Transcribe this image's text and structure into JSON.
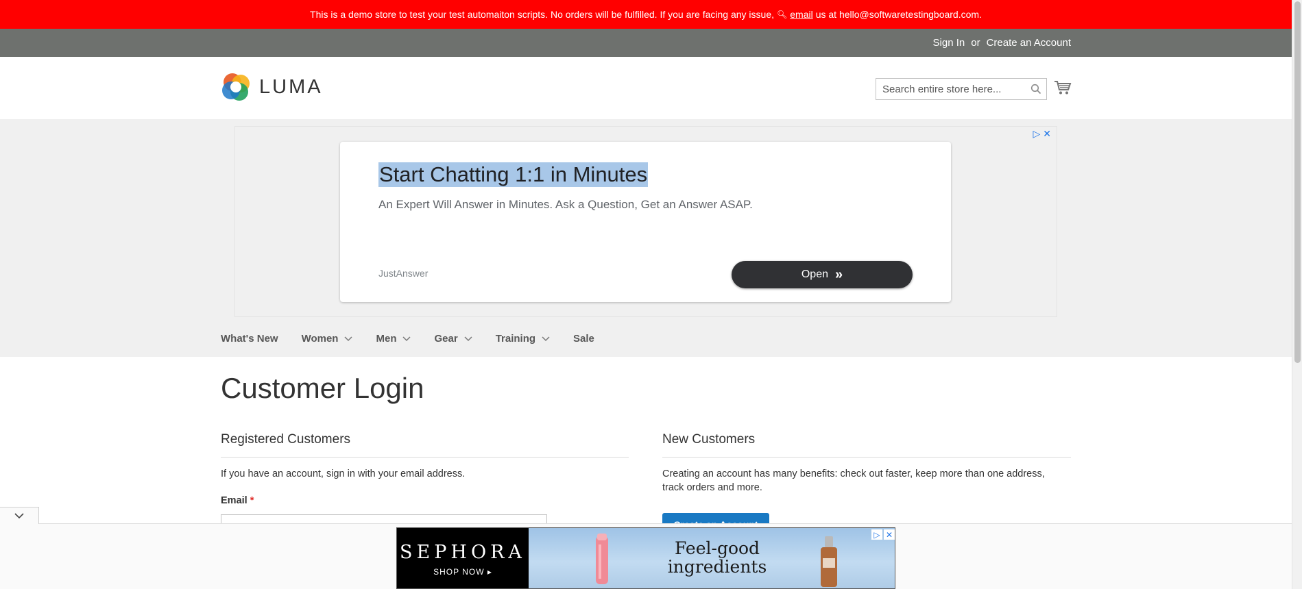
{
  "notice": {
    "text_before": "This is a demo store to test your test automaiton scripts. No orders will be fulfilled. If you are facing any issue,",
    "link": "email",
    "text_after": "us at hello@softwaretestingboard.com."
  },
  "header_links": {
    "sign_in": "Sign In",
    "or": "or",
    "create_account": "Create an Account"
  },
  "logo": {
    "text": "LUMA"
  },
  "search": {
    "placeholder": "Search entire store here..."
  },
  "ad": {
    "headline": "Start Chatting 1:1 in Minutes",
    "description": "An Expert Will Answer in Minutes. Ask a Question, Get an Answer ASAP.",
    "brand": "JustAnswer",
    "button": "Open"
  },
  "nav": {
    "items": [
      {
        "label": "What's New",
        "has_menu": false
      },
      {
        "label": "Women",
        "has_menu": true
      },
      {
        "label": "Men",
        "has_menu": true
      },
      {
        "label": "Gear",
        "has_menu": true
      },
      {
        "label": "Training",
        "has_menu": true
      },
      {
        "label": "Sale",
        "has_menu": false
      }
    ]
  },
  "page": {
    "title": "Customer Login"
  },
  "registered": {
    "title": "Registered Customers",
    "intro": "If you have an account, sign in with your email address.",
    "email_label": "Email",
    "required_mark": "*"
  },
  "new_customers": {
    "title": "New Customers",
    "text": "Creating an account has many benefits: check out faster, keep more than one address, track orders and more.",
    "button": "Create an Account"
  },
  "bottom_ad": {
    "brand": "SEPHORA",
    "cta": "SHOP NOW ▸",
    "copy_line1": "Feel-good",
    "copy_line2": "ingredients"
  },
  "colors": {
    "notice_bg": "#ff0000",
    "panel_bg": "#6e716e",
    "primary_button": "#1979c3",
    "required": "#e02b27"
  }
}
